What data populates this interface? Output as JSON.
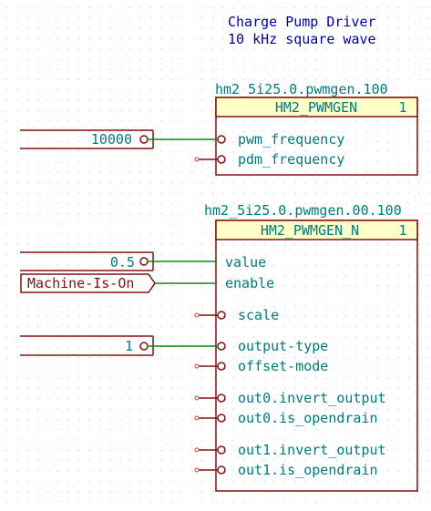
{
  "title": {
    "line1": "Charge Pump Driver",
    "line2": "10 kHz square wave"
  },
  "colors": {
    "grid_dot": "#b8b8b8",
    "component_border": "#8a0f0f",
    "component_fill": "#ffffc8",
    "wire": "#0a8a0a",
    "pin_text": "#007a7a",
    "title_text": "#0000aa",
    "label_text": "#7a1010"
  },
  "components": {
    "pwmgen": {
      "instance": "hm2_5i25.0.pwmgen.100",
      "type": "HM2_PWMGEN",
      "unit": "1",
      "pins": [
        {
          "name": "pwm_frequency",
          "input": "10000"
        },
        {
          "name": "pdm_frequency"
        }
      ]
    },
    "pwmgen_n": {
      "instance": "hm2_5i25.0.pwmgen.00.100",
      "type": "HM2_PWMGEN_N",
      "unit": "1",
      "pins": [
        {
          "name": "value",
          "input": "0.5"
        },
        {
          "name": "enable",
          "input": "Machine-Is-On"
        },
        {
          "name": "scale"
        },
        {
          "name": "output-type",
          "input": "1"
        },
        {
          "name": "offset-mode"
        },
        {
          "name": "out0.invert_output"
        },
        {
          "name": "out0.is_opendrain"
        },
        {
          "name": "out1.invert_output"
        },
        {
          "name": "out1.is_opendrain"
        }
      ]
    }
  }
}
